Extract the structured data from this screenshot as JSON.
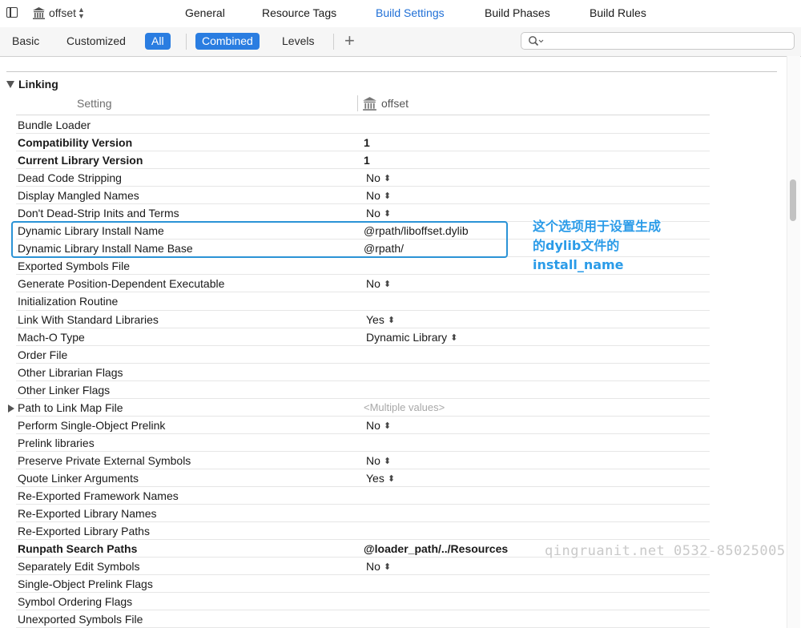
{
  "topbar": {
    "target": "offset",
    "tabs": [
      {
        "label": "General"
      },
      {
        "label": "Resource Tags"
      },
      {
        "label": "Build Settings",
        "active": true
      },
      {
        "label": "Build Phases"
      },
      {
        "label": "Build Rules"
      }
    ]
  },
  "filterbar": {
    "basic": "Basic",
    "customized": "Customized",
    "all": "All",
    "combined": "Combined",
    "levels": "Levels",
    "search_placeholder": ""
  },
  "section": {
    "title": "Linking",
    "col_setting": "Setting",
    "col_target": "offset"
  },
  "rows": [
    {
      "name": "Bundle Loader",
      "value": "",
      "bold": false
    },
    {
      "name": "Compatibility Version",
      "value": "1",
      "bold": true
    },
    {
      "name": "Current Library Version",
      "value": "1",
      "bold": true
    },
    {
      "name": "Dead Code Stripping",
      "value": "No",
      "popup": true
    },
    {
      "name": "Display Mangled Names",
      "value": "No",
      "popup": true
    },
    {
      "name": "Don't Dead-Strip Inits and Terms",
      "value": "No",
      "popup": true
    },
    {
      "name": "Dynamic Library Install Name",
      "value": "@rpath/liboffset.dylib"
    },
    {
      "name": "Dynamic Library Install Name Base",
      "value": "@rpath/"
    },
    {
      "name": "Exported Symbols File",
      "value": ""
    },
    {
      "name": "Generate Position-Dependent Executable",
      "value": "No",
      "popup": true
    },
    {
      "name": "Initialization Routine",
      "value": ""
    },
    {
      "name": "Link With Standard Libraries",
      "value": "Yes",
      "popup": true
    },
    {
      "name": "Mach-O Type",
      "value": "Dynamic Library",
      "popup": true
    },
    {
      "name": "Order File",
      "value": ""
    },
    {
      "name": "Other Librarian Flags",
      "value": ""
    },
    {
      "name": "Other Linker Flags",
      "value": ""
    },
    {
      "name": "Path to Link Map File",
      "value": "<Multiple values>",
      "disclosure": true,
      "multi": true
    },
    {
      "name": "Perform Single-Object Prelink",
      "value": "No",
      "popup": true
    },
    {
      "name": "Prelink libraries",
      "value": ""
    },
    {
      "name": "Preserve Private External Symbols",
      "value": "No",
      "popup": true
    },
    {
      "name": "Quote Linker Arguments",
      "value": "Yes",
      "popup": true
    },
    {
      "name": "Re-Exported Framework Names",
      "value": ""
    },
    {
      "name": "Re-Exported Library Names",
      "value": ""
    },
    {
      "name": "Re-Exported Library Paths",
      "value": ""
    },
    {
      "name": "Runpath Search Paths",
      "value": "@loader_path/../Resources",
      "bold": true
    },
    {
      "name": "Separately Edit Symbols",
      "value": "No",
      "popup": true
    },
    {
      "name": "Single-Object Prelink Flags",
      "value": ""
    },
    {
      "name": "Symbol Ordering Flags",
      "value": ""
    },
    {
      "name": "Unexported Symbols File",
      "value": ""
    }
  ],
  "annotation": {
    "lines": [
      "这个选项用于设置生成",
      "的dylib文件的",
      "install_name"
    ]
  },
  "watermark": "qingruanit.net 0532-85025005",
  "colors": {
    "accent": "#2a7de1",
    "annotation": "#2a9be8",
    "active_tab": "#1f6fd6"
  }
}
